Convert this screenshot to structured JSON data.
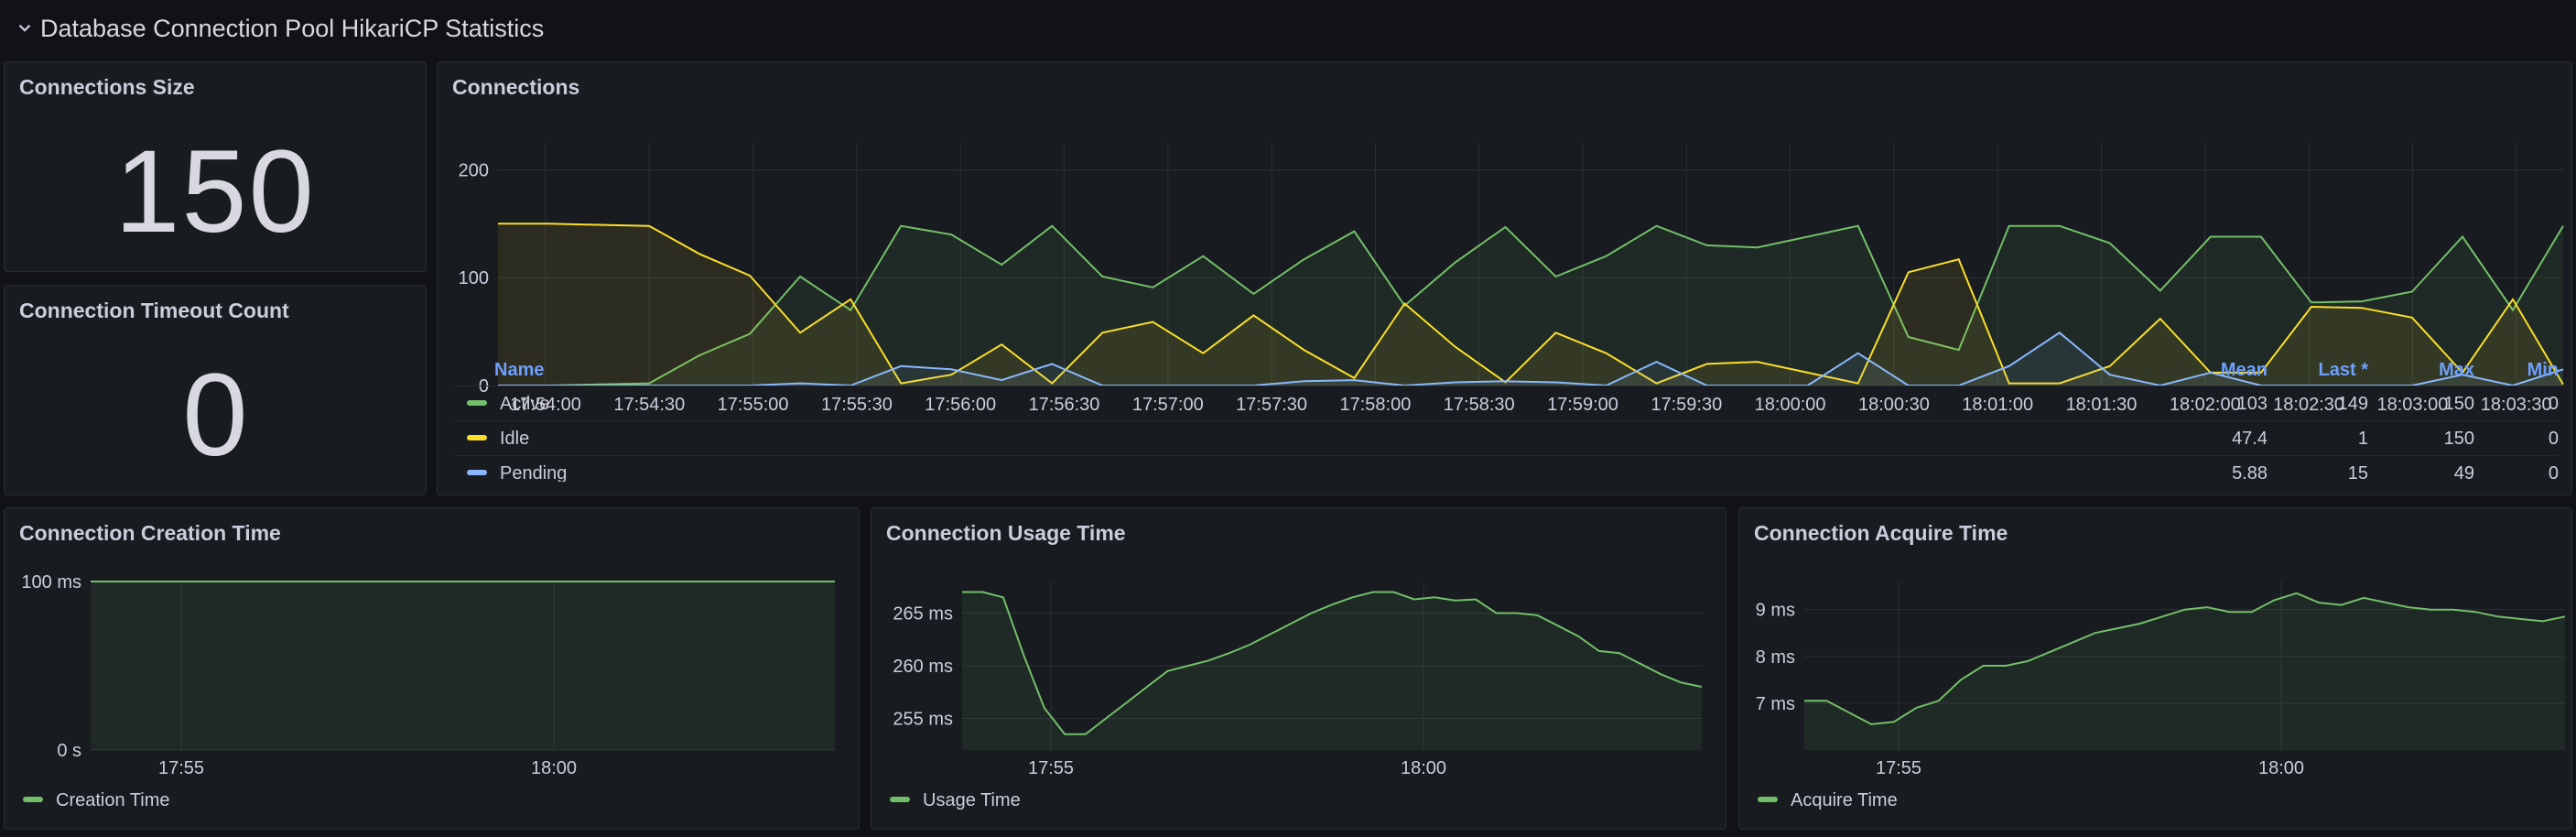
{
  "row": {
    "title": "Database Connection Pool HikariCP Statistics"
  },
  "colors": {
    "green": "#73bf69",
    "yellow": "#fade2a",
    "blue": "#8ab8ff",
    "grid": "#2c2f35",
    "axis": "#ccccdc"
  },
  "connections_size": {
    "title": "Connections Size",
    "value": "150"
  },
  "timeout_count": {
    "title": "Connection Timeout Count",
    "value": "0"
  },
  "connections": {
    "title": "Connections",
    "legend_headers": {
      "name": "Name",
      "mean": "Mean",
      "last": "Last *",
      "max": "Max",
      "min": "Min"
    },
    "legend_rows": [
      {
        "name": "Active",
        "mean": "103",
        "last": "149",
        "max": "150",
        "min": "0"
      },
      {
        "name": "Idle",
        "mean": "47.4",
        "last": "1",
        "max": "150",
        "min": "0"
      },
      {
        "name": "Pending",
        "mean": "5.88",
        "last": "15",
        "max": "49",
        "min": "0"
      }
    ]
  },
  "creation_time": {
    "title": "Connection Creation Time",
    "legend": "Creation Time"
  },
  "usage_time": {
    "title": "Connection Usage Time",
    "legend": "Usage Time"
  },
  "acquire_time": {
    "title": "Connection Acquire Time",
    "legend": "Acquire Time"
  },
  "chart_data": [
    {
      "type": "line",
      "title": "Connections",
      "x_ticks": [
        "17:54:00",
        "17:54:30",
        "17:55:00",
        "17:55:30",
        "17:56:00",
        "17:56:30",
        "17:57:00",
        "17:57:30",
        "17:58:00",
        "17:58:30",
        "17:59:00",
        "17:59:30",
        "18:00:00",
        "18:00:30",
        "18:01:00",
        "18:01:30",
        "18:02:00",
        "18:02:30",
        "18:03:00",
        "18:03:30"
      ],
      "y_ticks": [
        "0",
        "100",
        "200"
      ],
      "ylim": [
        0,
        225
      ],
      "series": [
        {
          "name": "Active",
          "values": [
            0,
            0,
            1,
            2,
            28,
            48,
            101,
            70,
            148,
            140,
            112,
            148,
            101,
            91,
            120,
            85,
            117,
            143,
            74,
            114,
            147,
            101,
            120,
            148,
            130,
            128,
            138,
            148,
            45,
            33,
            148,
            148,
            132,
            88,
            138,
            138,
            77,
            78,
            87,
            138,
            70,
            148
          ]
        },
        {
          "name": "Idle",
          "values": [
            150,
            150,
            149,
            148,
            122,
            102,
            49,
            80,
            2,
            10,
            38,
            2,
            49,
            59,
            30,
            65,
            33,
            7,
            76,
            36,
            3,
            49,
            30,
            2,
            20,
            22,
            12,
            2,
            105,
            117,
            2,
            2,
            18,
            62,
            12,
            12,
            73,
            72,
            63,
            12,
            80,
            1
          ]
        },
        {
          "name": "Pending",
          "values": [
            0,
            0,
            0,
            0,
            0,
            0,
            2,
            0,
            18,
            15,
            5,
            20,
            0,
            0,
            0,
            0,
            4,
            5,
            0,
            3,
            4,
            3,
            0,
            22,
            0,
            0,
            0,
            30,
            0,
            0,
            18,
            49,
            10,
            0,
            12,
            0,
            0,
            0,
            0,
            10,
            0,
            15
          ]
        }
      ]
    },
    {
      "type": "line",
      "title": "Connection Creation Time",
      "x_ticks": [
        "17:55",
        "18:00"
      ],
      "y_ticks": [
        "0 s",
        "100 ms"
      ],
      "ylim": [
        0,
        100
      ],
      "series": [
        {
          "name": "Creation Time",
          "values": [
            100,
            100,
            100,
            100,
            100,
            100,
            100,
            100,
            100,
            100,
            100,
            100,
            100,
            100,
            100,
            100,
            100,
            100,
            100,
            100
          ]
        }
      ]
    },
    {
      "type": "line",
      "title": "Connection Usage Time",
      "x_ticks": [
        "17:55",
        "18:00"
      ],
      "y_ticks": [
        "255 ms",
        "260 ms",
        "265 ms"
      ],
      "ylim": [
        252,
        268
      ],
      "series": [
        {
          "name": "Usage Time",
          "values": [
            267,
            267,
            266.5,
            261,
            256,
            253.5,
            253.5,
            255,
            256.5,
            258,
            259.5,
            260,
            260.5,
            261.2,
            262,
            263,
            264,
            265,
            265.8,
            266.5,
            267,
            267,
            266.3,
            266.5,
            266.2,
            266.3,
            265,
            265,
            264.8,
            263.8,
            262.8,
            261.4,
            261.2,
            260.2,
            259.2,
            258.4,
            258
          ]
        }
      ]
    },
    {
      "type": "line",
      "title": "Connection Acquire Time",
      "x_ticks": [
        "17:55",
        "18:00"
      ],
      "y_ticks": [
        "7 ms",
        "8 ms",
        "9 ms"
      ],
      "ylim": [
        6,
        9.6
      ],
      "series": [
        {
          "name": "Acquire Time",
          "values": [
            7.05,
            7.05,
            6.8,
            6.55,
            6.6,
            6.9,
            7.05,
            7.5,
            7.8,
            7.8,
            7.9,
            8.1,
            8.3,
            8.5,
            8.6,
            8.7,
            8.85,
            9.0,
            9.05,
            8.95,
            8.95,
            9.2,
            9.35,
            9.15,
            9.1,
            9.25,
            9.15,
            9.05,
            9.0,
            9.0,
            8.95,
            8.85,
            8.8,
            8.75,
            8.85
          ]
        }
      ]
    }
  ]
}
